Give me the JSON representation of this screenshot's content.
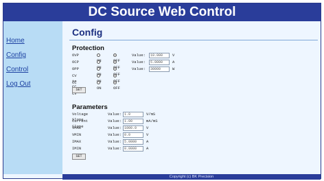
{
  "header": {
    "title": "DC Source Web Control"
  },
  "nav": {
    "items": [
      "Home",
      "Config",
      "Control",
      "Log Out"
    ]
  },
  "page": {
    "title": "Config"
  },
  "protection": {
    "title": "Protection",
    "on_label": "ON",
    "off_label": "OFF",
    "value_label": "Value:",
    "rows": [
      {
        "label": "OVP",
        "value": "10.000",
        "unit": "V"
      },
      {
        "label": "OCP",
        "value": "5.0000",
        "unit": "A"
      },
      {
        "label": "OPP",
        "value": "30000",
        "unit": "W"
      },
      {
        "label": "CV to CC"
      },
      {
        "label": "CC to CV"
      }
    ],
    "set_label": "SET"
  },
  "parameters": {
    "title": "Parameters",
    "value_label": "Value:",
    "rows": [
      {
        "label": "Voltage Slope",
        "value": "1.0",
        "unit": "V/mS"
      },
      {
        "label": "Current Slope",
        "value": "1.00",
        "unit": "mA/mS"
      },
      {
        "label": "VMAX",
        "value": "1000.0",
        "unit": "V"
      },
      {
        "label": "VMIN",
        "value": "0.0",
        "unit": "V"
      },
      {
        "label": "IMAX",
        "value": "5.0000",
        "unit": "A"
      },
      {
        "label": "IMIN",
        "value": "0.0000",
        "unit": "A"
      }
    ],
    "set_label": "SET"
  },
  "footer": {
    "text": "Copyright (c) BK Precision"
  },
  "colors": {
    "header": "#2a3d9a",
    "sidebar": "#b8dcf5",
    "link": "#1a3fa0"
  }
}
